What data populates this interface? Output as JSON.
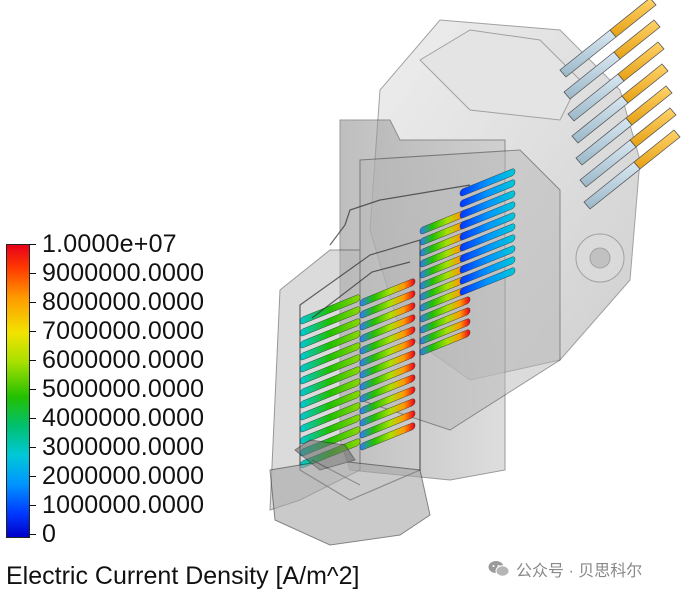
{
  "legend": {
    "title": "Electric Current Density [A/m^2]",
    "labels": [
      "1.0000e+07",
      "9000000.0000",
      "8000000.0000",
      "7000000.0000",
      "6000000.0000",
      "5000000.0000",
      "4000000.0000",
      "3000000.0000",
      "2000000.0000",
      "1000000.0000",
      "0"
    ],
    "colors": {
      "high": "#e8001a",
      "mid": "#22c000",
      "low": "#0000c8"
    }
  },
  "watermark": {
    "text": "公众号 · 贝思科尔",
    "icon": "wechat-icon"
  }
}
